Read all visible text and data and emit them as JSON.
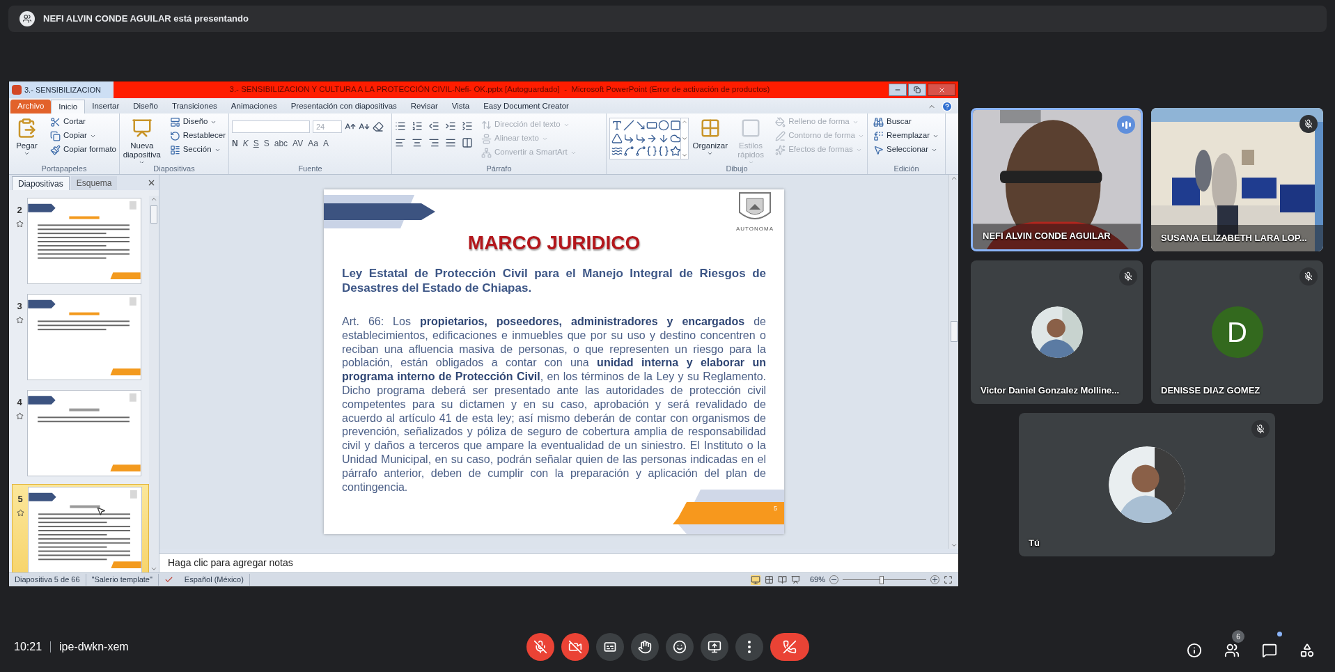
{
  "banner": {
    "text": "NEFI ALVIN CONDE AGUILAR está presentando"
  },
  "powerpoint": {
    "document_tab": "3.- SENSIBILIZACION",
    "title": "3.- SENSIBILIZACION Y CULTURA A LA PROTECCIÓN CIVIL-Nefi- OK.pptx [Autoguardado]  -  Microsoft PowerPoint (Error de activación de productos)",
    "ribbon_tabs": [
      {
        "label": "Archivo",
        "kind": "file",
        "selected": false
      },
      {
        "label": "Inicio",
        "kind": "tab",
        "selected": true
      },
      {
        "label": "Insertar",
        "kind": "tab",
        "selected": false
      },
      {
        "label": "Diseño",
        "kind": "tab",
        "selected": false
      },
      {
        "label": "Transiciones",
        "kind": "tab",
        "selected": false
      },
      {
        "label": "Animaciones",
        "kind": "tab",
        "selected": false
      },
      {
        "label": "Presentación con diapositivas",
        "kind": "tab",
        "selected": false
      },
      {
        "label": "Revisar",
        "kind": "tab",
        "selected": false
      },
      {
        "label": "Vista",
        "kind": "tab",
        "selected": false
      },
      {
        "label": "Easy Document Creator",
        "kind": "tab",
        "selected": false
      }
    ],
    "ribbon_groups": [
      {
        "kind": "clipboard",
        "label": "Portapapeles",
        "large": [
          {
            "label": "Pegar",
            "dropdown": true,
            "disabled": false
          }
        ],
        "small": [
          {
            "label": "Cortar",
            "dropdown": false,
            "disabled": false
          },
          {
            "label": "Copiar",
            "dropdown": true,
            "disabled": false
          },
          {
            "label": "Copiar formato",
            "dropdown": false,
            "disabled": false
          }
        ]
      },
      {
        "kind": "slides",
        "label": "Diapositivas",
        "large": [
          {
            "label": "Nueva diapositiva",
            "dropdown": true,
            "disabled": false
          }
        ],
        "small": [
          {
            "label": "Diseño",
            "dropdown": true,
            "disabled": false
          },
          {
            "label": "Restablecer",
            "dropdown": false,
            "disabled": false
          },
          {
            "label": "Sección",
            "dropdown": true,
            "disabled": false
          }
        ]
      },
      {
        "kind": "font",
        "label": "Fuente",
        "size_field": "24",
        "glyphs": [
          "N",
          "K",
          "S",
          "S",
          "abc",
          "AV",
          "Aa",
          "A"
        ]
      },
      {
        "kind": "paragraph",
        "label": "Párrafo",
        "small": [
          {
            "label": "Dirección del texto",
            "dropdown": true,
            "disabled": true
          },
          {
            "label": "Alinear texto",
            "dropdown": true,
            "disabled": true
          },
          {
            "label": "Convertir a SmartArt",
            "dropdown": true,
            "disabled": true
          }
        ]
      },
      {
        "kind": "drawing",
        "label": "Dibujo",
        "large": [
          {
            "label": "Organizar",
            "dropdown": true,
            "disabled": false
          },
          {
            "label": "Estilos rápidos",
            "dropdown": true,
            "disabled": true
          }
        ],
        "small": [
          {
            "label": "Relleno de forma",
            "dropdown": true,
            "disabled": true
          },
          {
            "label": "Contorno de forma",
            "dropdown": true,
            "disabled": true
          },
          {
            "label": "Efectos de formas",
            "dropdown": true,
            "disabled": true
          }
        ]
      },
      {
        "kind": "editing",
        "label": "Edición",
        "small": [
          {
            "label": "Buscar",
            "dropdown": false,
            "disabled": false
          },
          {
            "label": "Reemplazar",
            "dropdown": true,
            "disabled": false
          },
          {
            "label": "Seleccionar",
            "dropdown": true,
            "disabled": false
          }
        ]
      }
    ],
    "panel_tabs": [
      {
        "label": "Diapositivas",
        "selected": true
      },
      {
        "label": "Esquema",
        "selected": false
      }
    ],
    "slides": [
      {
        "number": "2",
        "selected": false
      },
      {
        "number": "3",
        "selected": false
      },
      {
        "number": "4",
        "selected": false
      },
      {
        "number": "5",
        "selected": true
      }
    ],
    "slide": {
      "logo_caption": "AUTONOMA",
      "title": "MARCO JURIDICO",
      "subtitle": "Ley Estatal de Protección Civil para el Manejo Integral de Riesgos de Desastres del Estado de Chiapas.",
      "body": "Art. 66: Los **propietarios, poseedores, administradores y encargados** de establecimientos, edificaciones e inmuebles que por su uso y destino concentren o reciban una afluencia masiva de personas, o que representen un riesgo para la población, están obligados a contar con una **unidad interna y elaborar un programa interno de Protección Civil**, en los términos de la Ley y su Reglamento. Dicho programa deberá ser presentado ante las autoridades de protección civil competentes para su dictamen y en su caso, aprobación y será revalidado de acuerdo al artículo 41 de esta ley; así mismo deberán de contar con organismos de prevención, señalizados y póliza de seguro de cobertura amplia de responsabilidad civil y daños a terceros que ampare la eventualidad de un siniestro. El Instituto o la Unidad Municipal, en su caso, podrán señalar quien de las personas indicadas en el párrafo anterior, deben de cumplir con la preparación y aplicación del plan de contingencia.",
      "page_number": "5"
    },
    "notes": "Haga clic para agregar notas",
    "status": {
      "slide_count": "Diapositiva 5 de 66",
      "theme": "\"Salerio template\"",
      "language": "Español (México)",
      "zoom": "69%",
      "zoom_slider": {
        "level": 0.47
      }
    }
  },
  "participants": [
    {
      "name": "NEFI ALVIN CONDE AGUILAR",
      "kind": "video",
      "speaking": true,
      "muted": false
    },
    {
      "name": "SUSANA ELIZABETH LARA LOP...",
      "kind": "video",
      "speaking": false,
      "muted": true
    },
    {
      "name": "Victor Daniel Gonzalez Molline...",
      "kind": "photo_avatar",
      "speaking": false,
      "muted": true
    },
    {
      "name": "DENISSE DIAZ GOMEZ",
      "kind": "letter_avatar",
      "letter": "D",
      "color": "#33691e",
      "speaking": false,
      "muted": true
    },
    {
      "name": "Tú",
      "kind": "photo_avatar",
      "speaking": false,
      "muted": true
    }
  ],
  "meeting": {
    "time": "10:21",
    "code": "ipe-dwkn-xem"
  },
  "controls": [
    {
      "kind": "mic",
      "on": false
    },
    {
      "kind": "camera",
      "on": false
    },
    {
      "kind": "captions",
      "on": false
    },
    {
      "kind": "hand"
    },
    {
      "kind": "emoji"
    },
    {
      "kind": "present"
    },
    {
      "kind": "more"
    },
    {
      "kind": "leave"
    }
  ],
  "side_buttons": [
    {
      "kind": "info"
    },
    {
      "kind": "people",
      "badge": "6"
    },
    {
      "kind": "chat",
      "unread": true
    },
    {
      "kind": "activities"
    }
  ]
}
